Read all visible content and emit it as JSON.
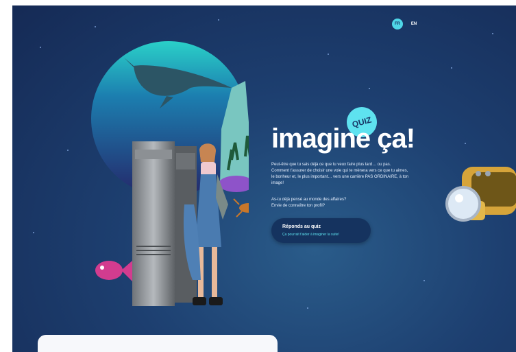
{
  "lang_switch": {
    "fr_label": "FR",
    "en_label": "EN",
    "active": "FR"
  },
  "hero": {
    "badge": "QUIZ",
    "title": "imagine ça!",
    "intro": "Peut-être que tu sais déjà ce que tu veux faire plus tard… ou pas. Comment t'assurer de choisir une voie qui te mènera vers ce que tu aimes, le bonheur et, le plus important… vers une carrière PAS ORDINAIRE, à ton image!",
    "question_1": "As-tu déjà pensé au monde des affaires?",
    "question_2": "Envie de connaître ton profil?"
  },
  "cta": {
    "label": "Réponds au quiz",
    "sublabel": "Ça pourrait t'aider à imaginer la suite!"
  },
  "colors": {
    "background": "#1d3f70",
    "accent": "#5ee2ef",
    "button": "#15335f",
    "text": "#ffffff"
  },
  "icons": [
    "whale-illustration",
    "fish-illustration",
    "locker-illustration",
    "submarine-illustration",
    "crab-illustration"
  ]
}
